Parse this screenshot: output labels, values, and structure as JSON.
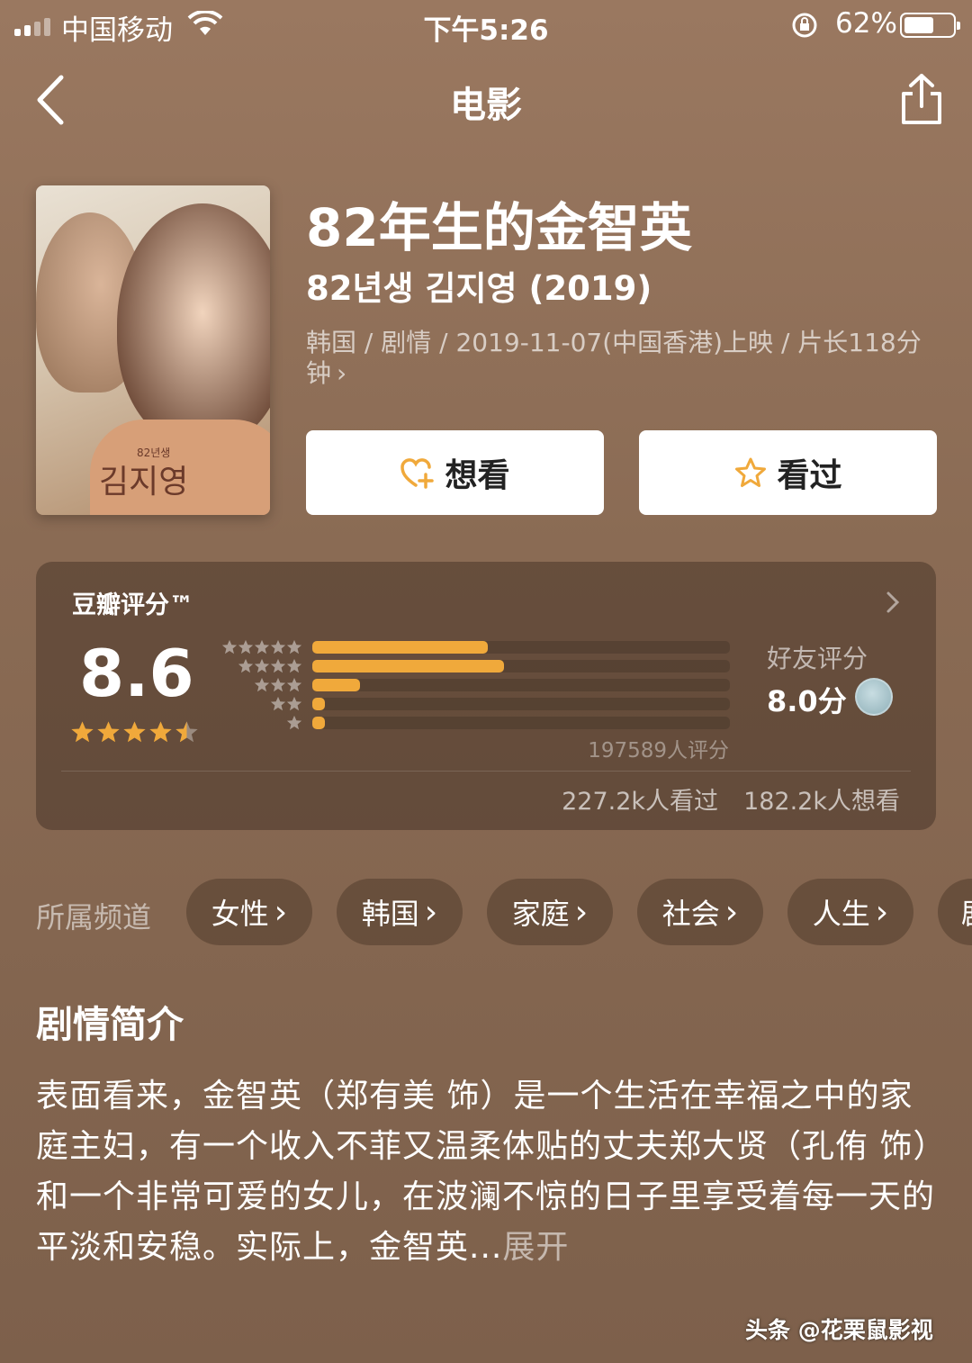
{
  "status_bar": {
    "carrier": "中国移动",
    "time": "下午5:26",
    "battery_percent": "62%",
    "battery_level": 0.62
  },
  "nav": {
    "title": "电影"
  },
  "movie": {
    "title": "82年生的金智英",
    "original_title": "82년생 김지영 (2019)",
    "meta": "韩国 / 剧情 / 2019-11-07(中国香港)上映 / 片长118分钟",
    "poster": {
      "title_text": "김지영",
      "subtitle_text": "82년생"
    }
  },
  "actions": {
    "want_label": "想看",
    "seen_label": "看过"
  },
  "rating": {
    "title": "豆瓣评分™",
    "score": "8.6",
    "stars": 4.5,
    "distribution": [
      {
        "stars": 5,
        "fraction": 0.42
      },
      {
        "stars": 4,
        "fraction": 0.46
      },
      {
        "stars": 3,
        "fraction": 0.115
      },
      {
        "stars": 2,
        "fraction": 0.03
      },
      {
        "stars": 1,
        "fraction": 0.03
      }
    ],
    "count": "197589人评分",
    "friend_label": "好友评分",
    "friend_score": "8.0分",
    "seen_count": "227.2k人看过",
    "want_count": "182.2k人想看"
  },
  "channels": {
    "label": "所属频道",
    "items": [
      "女性",
      "韩国",
      "家庭",
      "社会",
      "人生",
      "剧情"
    ]
  },
  "synopsis": {
    "title": "剧情简介",
    "text": "表面看来，金智英（郑有美 饰）是一个生活在幸福之中的家庭主妇，有一个收入不菲又温柔体贴的丈夫郑大贤（孔侑 饰）和一个非常可爱的女儿，在波澜不惊的日子里享受着每一天的平淡和安稳。实际上，金智英...",
    "expand_label": "展开"
  },
  "watermark": "头条 @花栗鼠影视",
  "colors": {
    "accent": "#f0a93b",
    "background": "#8a6b54"
  }
}
